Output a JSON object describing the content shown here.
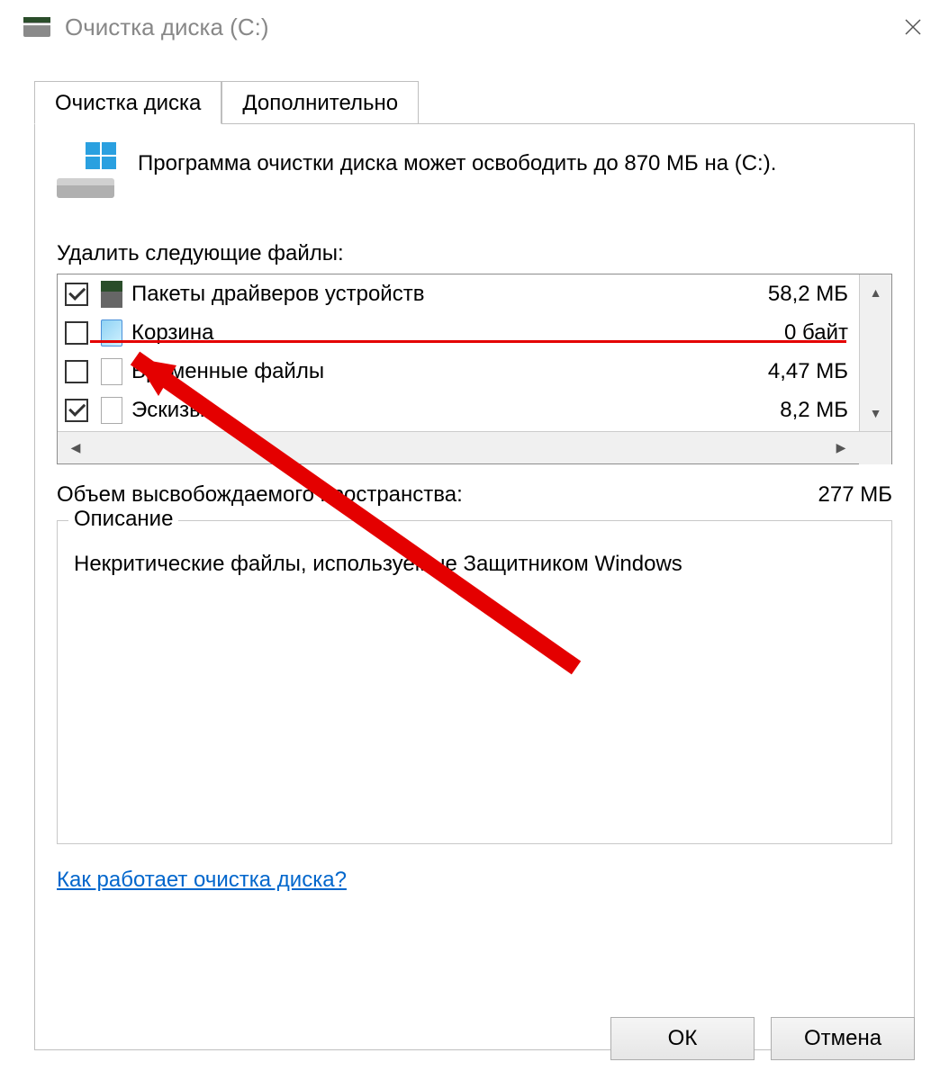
{
  "window": {
    "title": "Очистка диска  (C:)"
  },
  "tabs": {
    "cleanup": "Очистка диска",
    "advanced": "Дополнительно"
  },
  "info": {
    "text": "Программа очистки диска может освободить до 870 МБ на  (C:)."
  },
  "files": {
    "label": "Удалить следующие файлы:",
    "items": [
      {
        "checked": true,
        "icon": "drive",
        "name": "Пакеты драйверов устройств",
        "size": "58,2 МБ"
      },
      {
        "checked": false,
        "icon": "bin",
        "name": "Корзина",
        "size": "0 байт"
      },
      {
        "checked": false,
        "icon": "file",
        "name": "Временные файлы",
        "size": "4,47 МБ"
      },
      {
        "checked": true,
        "icon": "file",
        "name": "Эскизы",
        "size": "8,2 МБ"
      }
    ]
  },
  "summary": {
    "label": "Объем высвобождаемого пространства:",
    "value": "277 МБ"
  },
  "description": {
    "legend": "Описание",
    "text": "Некритические файлы, используемые Защитником Windows"
  },
  "help_link": "Как работает очистка диска?",
  "buttons": {
    "ok": "ОК",
    "cancel": "Отмена"
  }
}
